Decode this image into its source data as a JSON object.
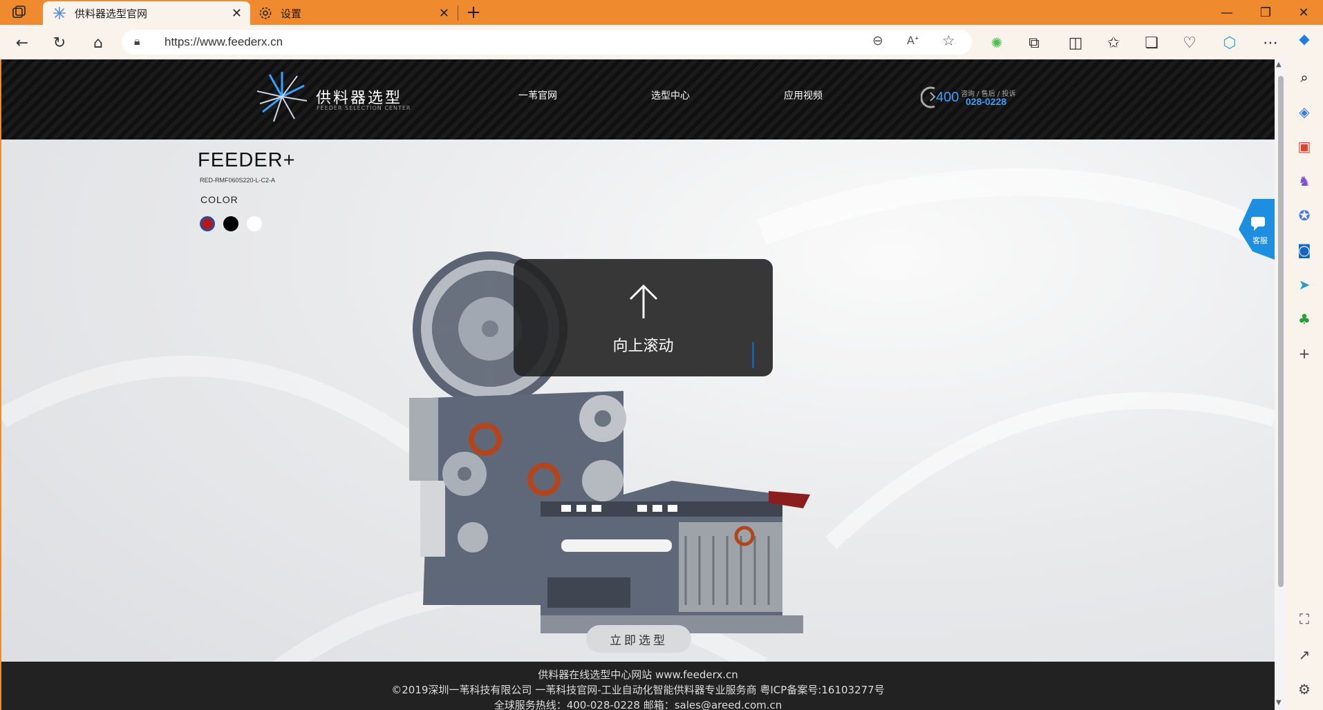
{
  "browser": {
    "tabs": [
      {
        "label": "供料器选型官网",
        "active": true
      },
      {
        "label": "设置",
        "active": false
      }
    ],
    "url": "https://www.feederx.cn"
  },
  "site": {
    "logo": {
      "title": "供料器选型",
      "subtitle": "FEEDER SELECTION CENTER"
    },
    "nav": [
      "一苇官网",
      "选型中心",
      "应用视频"
    ],
    "hotline": {
      "label": "咨询 / 售后 / 投诉",
      "prefix": "400",
      "number": "028-0228"
    }
  },
  "product": {
    "title": "FEEDER+",
    "model": "RED-RMF060S220-L-C2-A",
    "color_label": "COLOR",
    "colors": [
      "#b11a1a",
      "#000000",
      "#ffffff"
    ]
  },
  "overlay": {
    "text": "向上滚动",
    "icon": "arrow-up-icon"
  },
  "select_button": "立即选型",
  "service_label": "客服",
  "footer": {
    "line1": "供料器在线选型中心网站 www.feederx.cn",
    "line2": "©2019深圳一苇科技有限公司 一苇科技官网-工业自动化智能供料器专业服务商 粤ICP备案号:16103277号",
    "line3": "全球服务热线：400-028-0228    邮箱：sales@areed.com.cn"
  }
}
